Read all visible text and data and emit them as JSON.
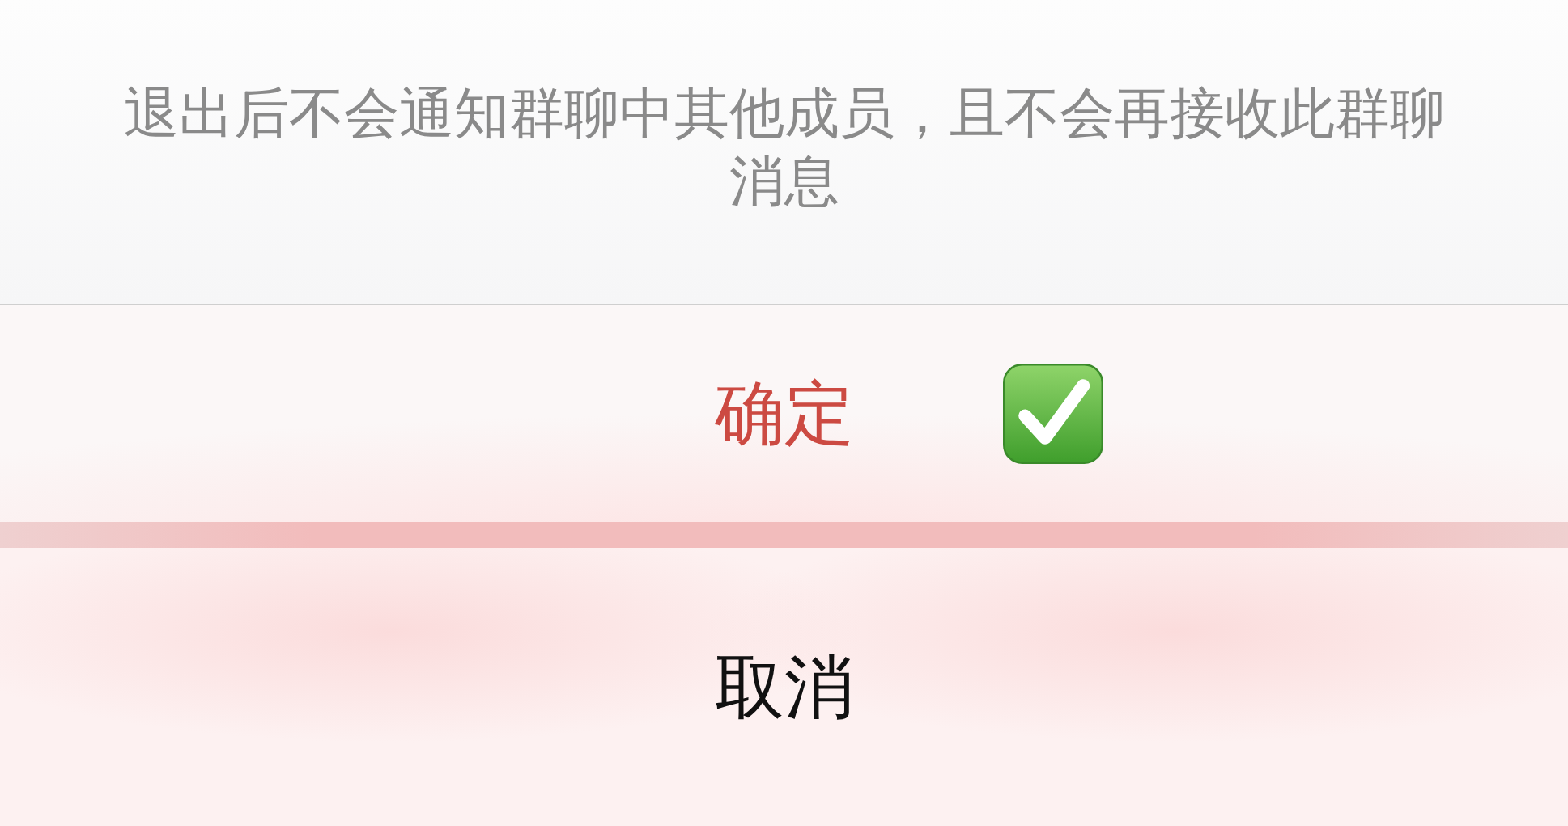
{
  "sheet": {
    "message": "退出后不会通知群聊中其他成员，且不会再接收此群聊消息",
    "actions": [
      {
        "label": "确定",
        "kind": "destructive"
      },
      {
        "label": "取消",
        "kind": "cancel"
      }
    ]
  }
}
